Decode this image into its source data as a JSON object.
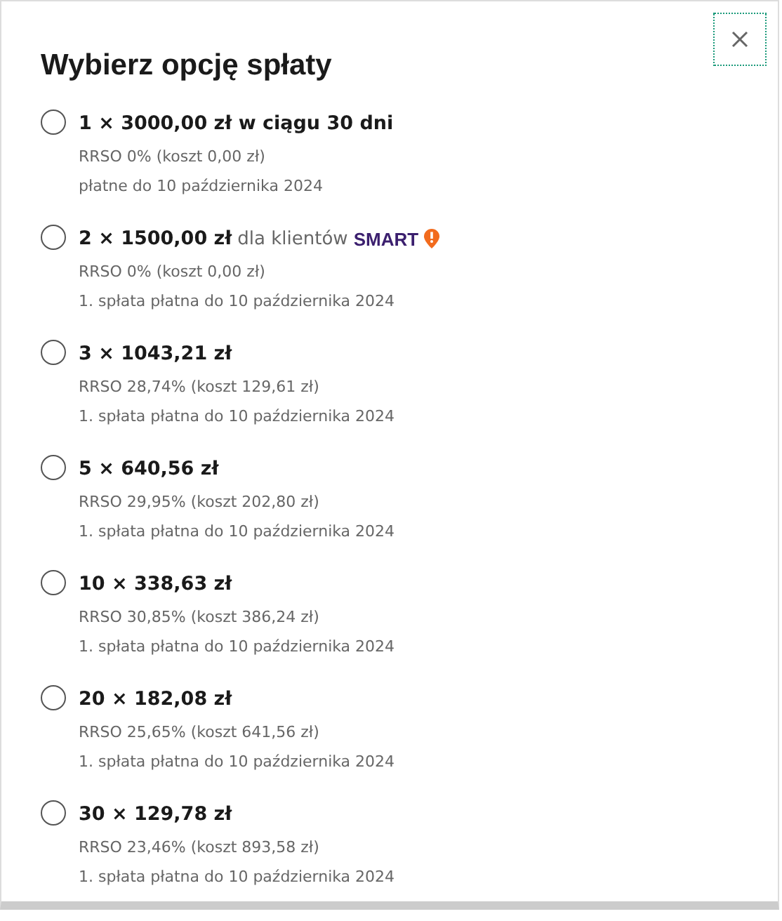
{
  "dialog": {
    "title": "Wybierz opcję spłaty"
  },
  "options": [
    {
      "amount": "1 × 3000,00 zł w ciągu 30 dni",
      "rrso": "RRSO 0% (koszt 0,00 zł)",
      "due": "płatne do 10 października 2024",
      "selected": false
    },
    {
      "amount": "2 × 1500,00 zł",
      "note": "dla klientów",
      "brand": "SMART",
      "rrso": "RRSO 0% (koszt 0,00 zł)",
      "due": "1. spłata płatna do 10 października 2024",
      "selected": false
    },
    {
      "amount": "3 × 1043,21 zł",
      "rrso": "RRSO 28,74% (koszt 129,61 zł)",
      "due": "1. spłata płatna do 10 października 2024",
      "selected": false
    },
    {
      "amount": "5 × 640,56 zł",
      "rrso": "RRSO 29,95% (koszt 202,80 zł)",
      "due": "1. spłata płatna do 10 października 2024",
      "selected": false
    },
    {
      "amount": "10 × 338,63 zł",
      "rrso": "RRSO 30,85% (koszt 386,24 zł)",
      "due": "1. spłata płatna do 10 października 2024",
      "selected": false
    },
    {
      "amount": "20 × 182,08 zł",
      "rrso": "RRSO 25,65% (koszt 641,56 zł)",
      "due": "1. spłata płatna do 10 października 2024",
      "selected": false
    },
    {
      "amount": "30 × 129,78 zł",
      "rrso": "RRSO 23,46% (koszt 893,58 zł)",
      "due": "1. spłata płatna do 10 października 2024",
      "selected": false
    }
  ]
}
